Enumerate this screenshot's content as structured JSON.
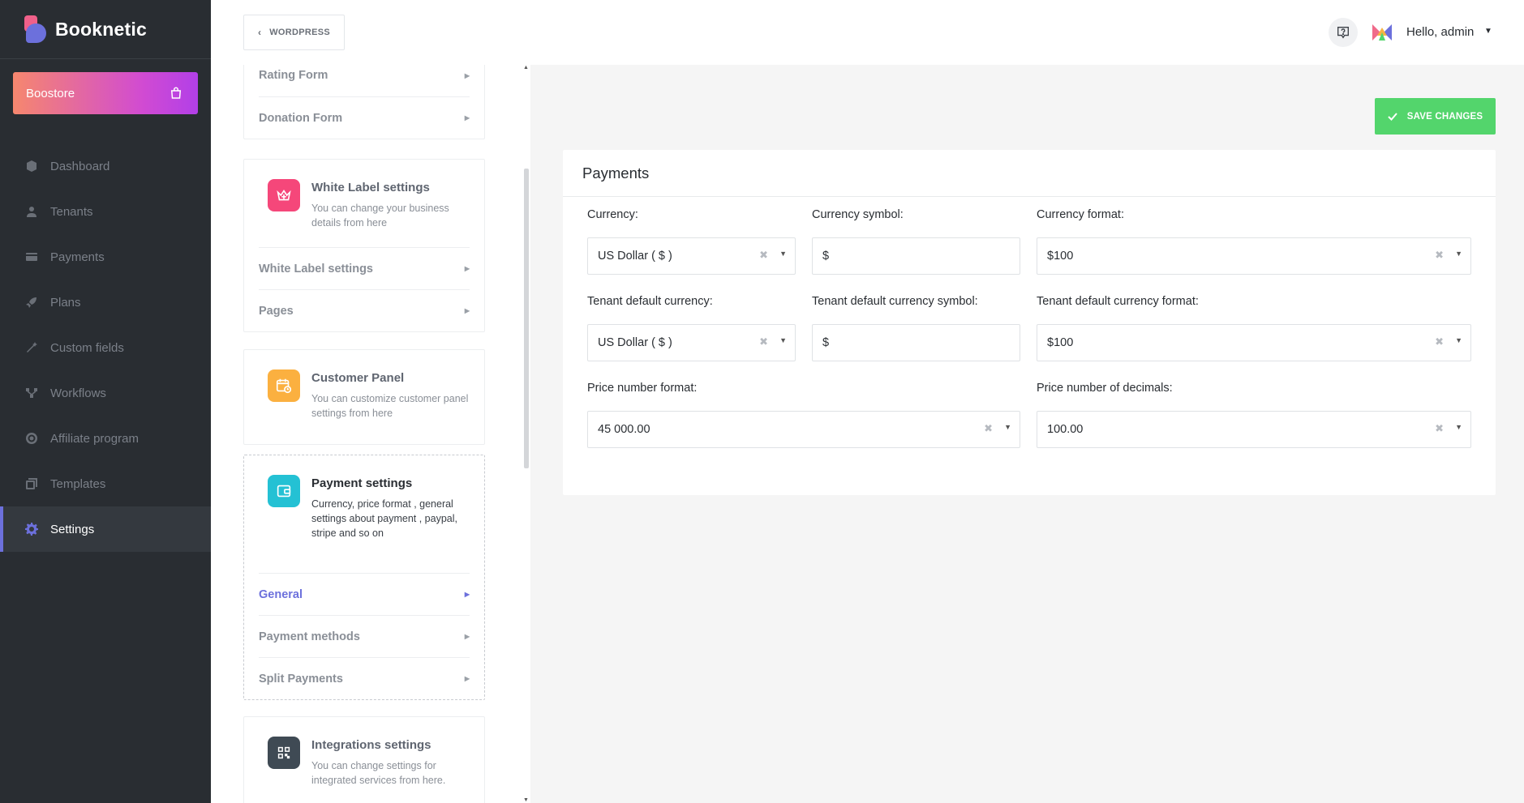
{
  "brand": {
    "name": "Booknetic"
  },
  "boostore": {
    "label": "Boostore"
  },
  "nav": [
    {
      "label": "Dashboard",
      "icon": "cube-icon"
    },
    {
      "label": "Tenants",
      "icon": "user-icon"
    },
    {
      "label": "Payments",
      "icon": "card-icon"
    },
    {
      "label": "Plans",
      "icon": "rocket-icon"
    },
    {
      "label": "Custom fields",
      "icon": "wand-icon"
    },
    {
      "label": "Workflows",
      "icon": "workflow-icon"
    },
    {
      "label": "Affiliate program",
      "icon": "target-icon"
    },
    {
      "label": "Templates",
      "icon": "templates-icon"
    },
    {
      "label": "Settings",
      "icon": "gear-icon",
      "active": true
    }
  ],
  "topbar": {
    "wordpress_label": "WORDPRESS",
    "greeting": "Hello, admin"
  },
  "settings_cards": {
    "top_items": [
      "Rating Form",
      "Donation Form"
    ],
    "white_label": {
      "title": "White Label settings",
      "desc": "You can change your business details from here",
      "items": [
        "White Label settings",
        "Pages"
      ],
      "color": "#f5477a"
    },
    "customer_panel": {
      "title": "Customer Panel",
      "desc": "You can customize customer panel settings from here",
      "color": "#fbb040"
    },
    "payment": {
      "title": "Payment settings",
      "desc": "Currency, price format , general settings about payment , paypal, stripe and so on",
      "items": [
        "General",
        "Payment methods",
        "Split Payments"
      ],
      "active_item": "General",
      "color": "#24c1d4"
    },
    "integrations": {
      "title": "Integrations settings",
      "desc": "You can change settings for integrated services from here.",
      "color": "#3f4a54"
    }
  },
  "save_button": {
    "label": "SAVE CHANGES"
  },
  "panel": {
    "title": "Payments",
    "fields": {
      "currency": {
        "label": "Currency:",
        "value": "US Dollar ( $ )"
      },
      "currency_symbol": {
        "label": "Currency symbol:",
        "value": "$"
      },
      "currency_format": {
        "label": "Currency format:",
        "value": "$100"
      },
      "tenant_currency": {
        "label": "Tenant default currency:",
        "value": "US Dollar ( $ )"
      },
      "tenant_currency_symbol": {
        "label": "Tenant default currency symbol:",
        "value": "$"
      },
      "tenant_currency_format": {
        "label": "Tenant default currency format:",
        "value": "$100"
      },
      "price_number_format": {
        "label": "Price number format:",
        "value": "45 000.00"
      },
      "price_decimals": {
        "label": "Price number of decimals:",
        "value": "100.00"
      }
    }
  },
  "colors": {
    "accent": "#6c70dc",
    "save": "#53d56c",
    "sidebar": "#292d32"
  }
}
